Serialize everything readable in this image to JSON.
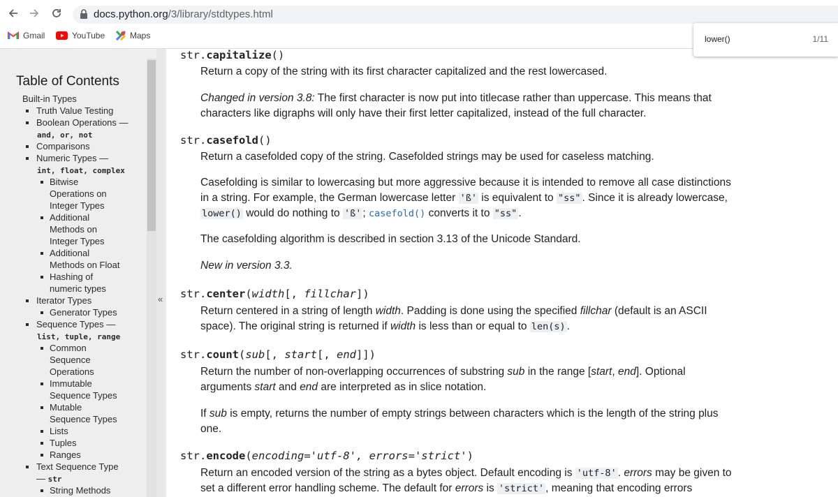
{
  "browser": {
    "url_host": "docs.python.org",
    "url_path": "/3/library/stdtypes.html",
    "bookmarks": [
      "Gmail",
      "YouTube",
      "Maps"
    ],
    "find": {
      "query": "lower()",
      "count": "1/11"
    }
  },
  "sidebar": {
    "title": "Table of Contents",
    "collapse": "«",
    "items": [
      {
        "text": "Built-in Types"
      },
      {
        "text": "Truth Value Testing"
      },
      {
        "text": "Boolean Operations —"
      },
      {
        "code": "and, or, not"
      },
      {
        "text": "Comparisons"
      },
      {
        "text": "Numeric Types —"
      },
      {
        "code": "int, float, complex"
      },
      {
        "text": "Bitwise"
      },
      {
        "text": "Operations on"
      },
      {
        "text": "Integer Types"
      },
      {
        "text": "Additional"
      },
      {
        "text": "Methods on"
      },
      {
        "text": "Integer Types"
      },
      {
        "text": "Additional"
      },
      {
        "text": "Methods on Float"
      },
      {
        "text": "Hashing of"
      },
      {
        "text": "numeric types"
      },
      {
        "text": "Iterator Types"
      },
      {
        "text": "Generator Types"
      },
      {
        "text": "Sequence Types —"
      },
      {
        "code": "list, tuple, range"
      },
      {
        "text": "Common"
      },
      {
        "text": "Sequence"
      },
      {
        "text": "Operations"
      },
      {
        "text": "Immutable"
      },
      {
        "text": "Sequence Types"
      },
      {
        "text": "Mutable"
      },
      {
        "text": "Sequence Types"
      },
      {
        "text": "Lists"
      },
      {
        "text": "Tuples"
      },
      {
        "text": "Ranges"
      },
      {
        "text": "Text Sequence Type"
      },
      {
        "text": "— ",
        "code": "str"
      },
      {
        "text": "String Methods"
      }
    ]
  },
  "main": {
    "capitalize": {
      "prefix": "str.",
      "name": "capitalize",
      "args": "()",
      "desc": "Return a copy of the string with its first character capitalized and the rest lowercased.",
      "changed_label": "Changed in version 3.8:",
      "changed_text": " The first character is now put into titlecase rather than uppercase. This means that characters like digraphs will only have their first letter capitalized, instead of the full character."
    },
    "casefold": {
      "prefix": "str.",
      "name": "casefold",
      "args": "()",
      "desc": "Return a casefolded copy of the string. Casefolded strings may be used for caseless matching.",
      "p2_a": "Casefolding is similar to lowercasing but more aggressive because it is intended to remove all case distinctions in a string. For example, the German lowercase letter ",
      "code_sz": "'ß'",
      "p2_b": " is equivalent to ",
      "code_ss": "\"ss\"",
      "p2_c": ". Since it is already lowercase, ",
      "code_lower": "lower()",
      "p2_d": " would do nothing to ",
      "code_sz2": "'ß'",
      "p2_e": "; ",
      "code_casefold": "casefold()",
      "p2_f": " converts it to ",
      "code_ss2": "\"ss\"",
      "p2_g": ".",
      "p3": "The casefolding algorithm is described in section 3.13 of the Unicode Standard.",
      "new": "New in version 3.3."
    },
    "center": {
      "prefix": "str.",
      "name": "center",
      "open": "(",
      "arg1": "width",
      "opt": "[, ",
      "arg2": "fillchar",
      "close": "])",
      "p_a": "Return centered in a string of length ",
      "p_width": "width",
      "p_b": ". Padding is done using the specified ",
      "p_fill": "fillchar",
      "p_c": " (default is an ASCII space). The original string is returned if ",
      "p_width2": "width",
      "p_d": " is less than or equal to ",
      "p_code": "len(s)",
      "p_e": "."
    },
    "count": {
      "prefix": "str.",
      "name": "count",
      "open": "(",
      "arg1": "sub",
      "opt1": "[, ",
      "arg2": "start",
      "opt2": "[, ",
      "arg3": "end",
      "close": "]])",
      "p_a": "Return the number of non-overlapping occurrences of substring ",
      "p_sub": "sub",
      "p_b": " in the range [",
      "p_start": "start",
      "p_c": ", ",
      "p_end": "end",
      "p_d": "]. Optional arguments ",
      "p_start2": "start",
      "p_e": " and ",
      "p_end2": "end",
      "p_f": " are interpreted as in slice notation.",
      "p2_a": "If ",
      "p2_sub": "sub",
      "p2_b": " is empty, returns the number of empty strings between characters which is the length of the string plus one."
    },
    "encode": {
      "prefix": "str.",
      "name": "encode",
      "open": "(",
      "args": "encoding='utf-8', errors='strict'",
      "close": ")",
      "p_a": "Return an encoded version of the string as a bytes object. Default encoding is ",
      "p_code1": "'utf-8'",
      "p_b": ". ",
      "p_errors": "errors",
      "p_c": " may be given to set a different error handling scheme. The default for ",
      "p_errors2": "errors",
      "p_d": " is ",
      "p_code2": "'strict'",
      "p_e": ", meaning that encoding errors"
    }
  }
}
